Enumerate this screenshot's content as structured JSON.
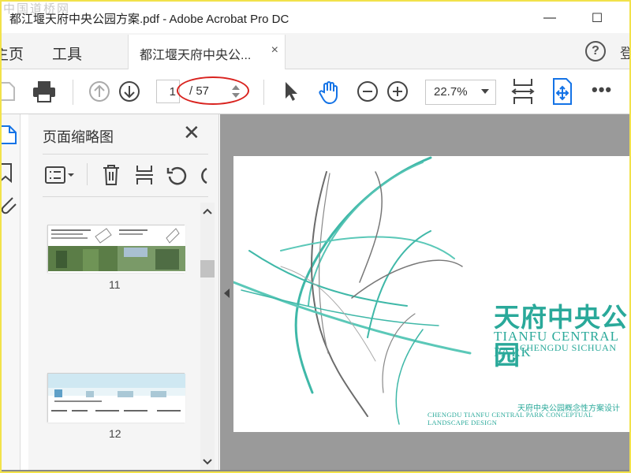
{
  "window": {
    "title": "都江堰天府中央公园方案.pdf - Adobe Acrobat Pro DC",
    "watermark": "中国道桥网",
    "minimize": "—",
    "maximize": "☐"
  },
  "menu": {
    "home": "主页",
    "tools": "工具"
  },
  "tab": {
    "label": "都江堰天府中央公...",
    "close": "×"
  },
  "help": "?",
  "toolbar": {
    "current_page": "1",
    "page_total": "/ 57",
    "zoom": "22.7%",
    "more": "•••"
  },
  "thumbnail_panel": {
    "title": "页面缩略图",
    "close": "✕",
    "thumbnails": [
      {
        "page": "11"
      },
      {
        "page": "12"
      }
    ]
  },
  "document": {
    "title_cn": "天府中央公园",
    "title_en": "TIANFU CENTRAL PARK",
    "subtitle_en": "CHENGDU SICHUAN",
    "caption_cn": "天府中央公园概念性方案设计",
    "caption_en": "CHENGDU TIANFU CENTRAL PARK CONCEPTUAL LANDSCAPE DESIGN"
  },
  "colors": {
    "accent_teal": "#2aa99a",
    "annotation_red": "#d9231f",
    "active_blue": "#1473e6",
    "window_border": "#f2e24a"
  }
}
